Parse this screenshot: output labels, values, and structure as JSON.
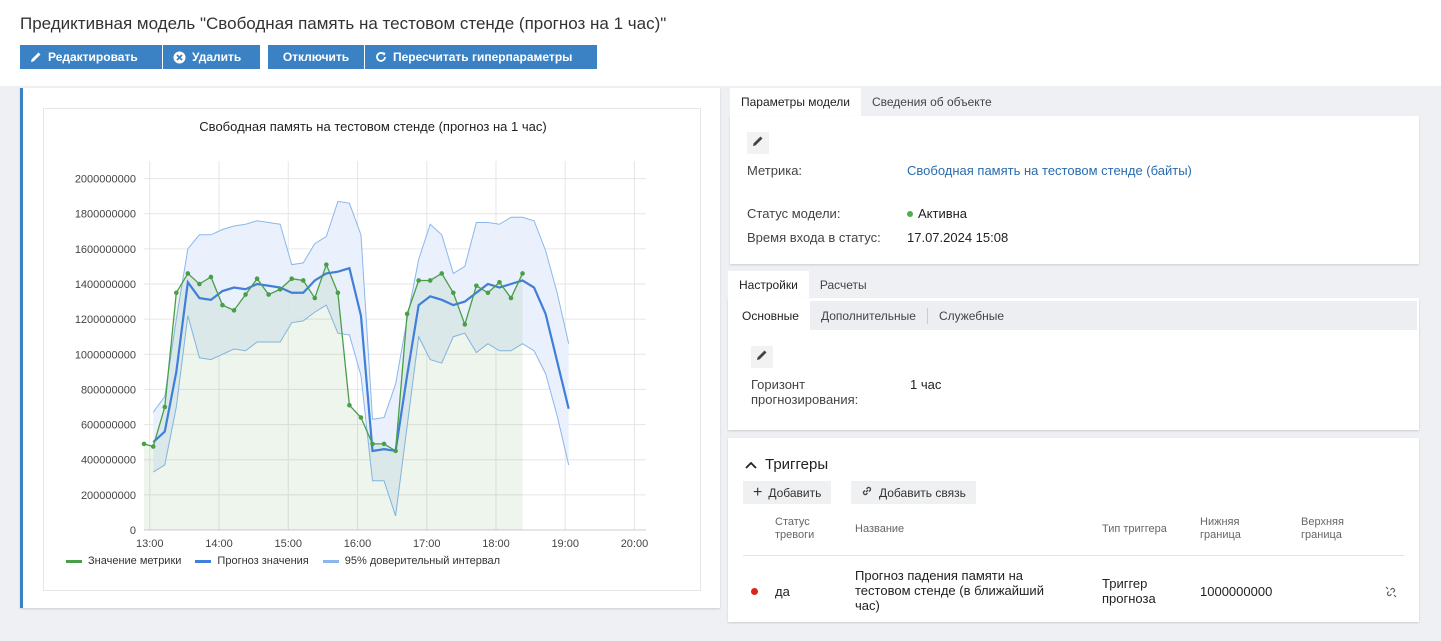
{
  "header": {
    "title": "Предиктивная модель \"Свободная память на тестовом стенде (прогноз на 1 час)\"",
    "buttons": {
      "edit": "Редактировать",
      "delete": "Удалить",
      "disable": "Отключить",
      "recalc": "Пересчитать гиперпараметры"
    }
  },
  "chart_data": {
    "type": "line",
    "title": "Свободная память на тестовом стенде (прогноз на 1 час)",
    "x_ticks": [
      "13:00",
      "14:00",
      "15:00",
      "16:00",
      "17:00",
      "18:00",
      "19:00",
      "20:00"
    ],
    "y_ticks": [
      "0",
      "200000000",
      "400000000",
      "600000000",
      "800000000",
      "1000000000",
      "1200000000",
      "1400000000",
      "1600000000",
      "1800000000",
      "2000000000"
    ],
    "ylim": [
      0,
      2100000000
    ],
    "xlim": [
      "12:55",
      "20:10"
    ],
    "grid": true,
    "legend_position": "bottom-left",
    "x": [
      "12:55",
      "13:03",
      "13:13",
      "13:23",
      "13:33",
      "13:43",
      "13:53",
      "14:03",
      "14:13",
      "14:23",
      "14:33",
      "14:43",
      "14:53",
      "15:03",
      "15:13",
      "15:23",
      "15:33",
      "15:43",
      "15:53",
      "16:03",
      "16:13",
      "16:23",
      "16:33",
      "16:43",
      "16:53",
      "17:03",
      "17:13",
      "17:23",
      "17:33",
      "17:43",
      "17:53",
      "18:03",
      "18:13",
      "18:23",
      "18:33",
      "18:43",
      "18:53",
      "19:03",
      "19:13",
      "19:23",
      "19:33",
      "19:43"
    ],
    "series": [
      {
        "name": "Значение метрики",
        "color": "#4a9e48",
        "values": [
          490000000,
          475000000,
          700000000,
          1350000000,
          1460000000,
          1400000000,
          1440000000,
          1280000000,
          1250000000,
          1340000000,
          1430000000,
          1340000000,
          1370000000,
          1430000000,
          1420000000,
          1320000000,
          1510000000,
          1350000000,
          710000000,
          640000000,
          490000000,
          490000000,
          450000000,
          1230000000,
          1420000000,
          1420000000,
          1460000000,
          1350000000,
          1170000000,
          1390000000,
          1350000000,
          1410000000,
          1320000000,
          1460000000,
          null,
          null,
          null,
          null,
          null,
          null,
          null,
          null
        ]
      },
      {
        "name": "Прогноз значения",
        "color": "#3f7fd9",
        "values": [
          null,
          500000000,
          560000000,
          900000000,
          1410000000,
          1320000000,
          1310000000,
          1360000000,
          1380000000,
          1370000000,
          1400000000,
          1390000000,
          1380000000,
          1350000000,
          1350000000,
          1420000000,
          1460000000,
          1470000000,
          1490000000,
          1220000000,
          450000000,
          460000000,
          450000000,
          880000000,
          1280000000,
          1330000000,
          1310000000,
          1280000000,
          1300000000,
          1350000000,
          1400000000,
          1380000000,
          1400000000,
          1420000000,
          1380000000,
          1230000000,
          960000000,
          690000000,
          null,
          null,
          null,
          null
        ]
      },
      {
        "name": "95% доверительный интервал",
        "color": "#8ab7ee",
        "upper": [
          null,
          670000000,
          760000000,
          1200000000,
          1600000000,
          1680000000,
          1680000000,
          1710000000,
          1730000000,
          1740000000,
          1760000000,
          1750000000,
          1740000000,
          1510000000,
          1520000000,
          1630000000,
          1670000000,
          1870000000,
          1860000000,
          1680000000,
          630000000,
          640000000,
          830000000,
          1200000000,
          1540000000,
          1740000000,
          1680000000,
          1460000000,
          1500000000,
          1750000000,
          1750000000,
          1740000000,
          1780000000,
          1780000000,
          1760000000,
          1590000000,
          1350000000,
          1060000000,
          null,
          null,
          null,
          null
        ],
        "lower": [
          null,
          330000000,
          370000000,
          700000000,
          1220000000,
          980000000,
          970000000,
          1000000000,
          1030000000,
          1020000000,
          1070000000,
          1070000000,
          1070000000,
          1180000000,
          1190000000,
          1240000000,
          1280000000,
          1120000000,
          1110000000,
          880000000,
          280000000,
          280000000,
          80000000,
          590000000,
          1100000000,
          970000000,
          950000000,
          1100000000,
          1120000000,
          1010000000,
          1060000000,
          1020000000,
          1020000000,
          1060000000,
          1020000000,
          890000000,
          650000000,
          370000000,
          null,
          null,
          null,
          null
        ]
      }
    ]
  },
  "model_params": {
    "tabs": [
      "Параметры модели",
      "Сведения об объекте"
    ],
    "metric_label": "Метрика:",
    "metric_value": "Свободная память на тестовом стенде (байты)",
    "status_label": "Статус модели:",
    "status_value": "Активна",
    "status_color": "#4caf50",
    "time_label": "Время входа в статус:",
    "time_value": "17.07.2024 15:08"
  },
  "settings": {
    "tabs": [
      "Настройки",
      "Расчеты"
    ],
    "subtabs": [
      "Основные",
      "Дополнительные",
      "Служебные"
    ],
    "horizon_label_1": "Горизонт",
    "horizon_label_2": "прогнозирования:",
    "horizon_value": "1 час"
  },
  "triggers": {
    "title": "Триггеры",
    "add_label": "Добавить",
    "add_link_label": "Добавить связь",
    "columns": {
      "alarm_1": "Статус",
      "alarm_2": "тревоги",
      "name": "Название",
      "type": "Тип триггера",
      "lower_1": "Нижняя",
      "lower_2": "граница",
      "upper_1": "Верхняя",
      "upper_2": "граница"
    },
    "rows": [
      {
        "alarm": "да",
        "alarm_color": "#e0201b",
        "name_1": "Прогноз падения памяти на",
        "name_2": "тестовом стенде (в ближайший",
        "name_3": "час)",
        "type_1": "Триггер",
        "type_2": "прогноза",
        "lower": "1000000000",
        "upper": ""
      }
    ]
  }
}
